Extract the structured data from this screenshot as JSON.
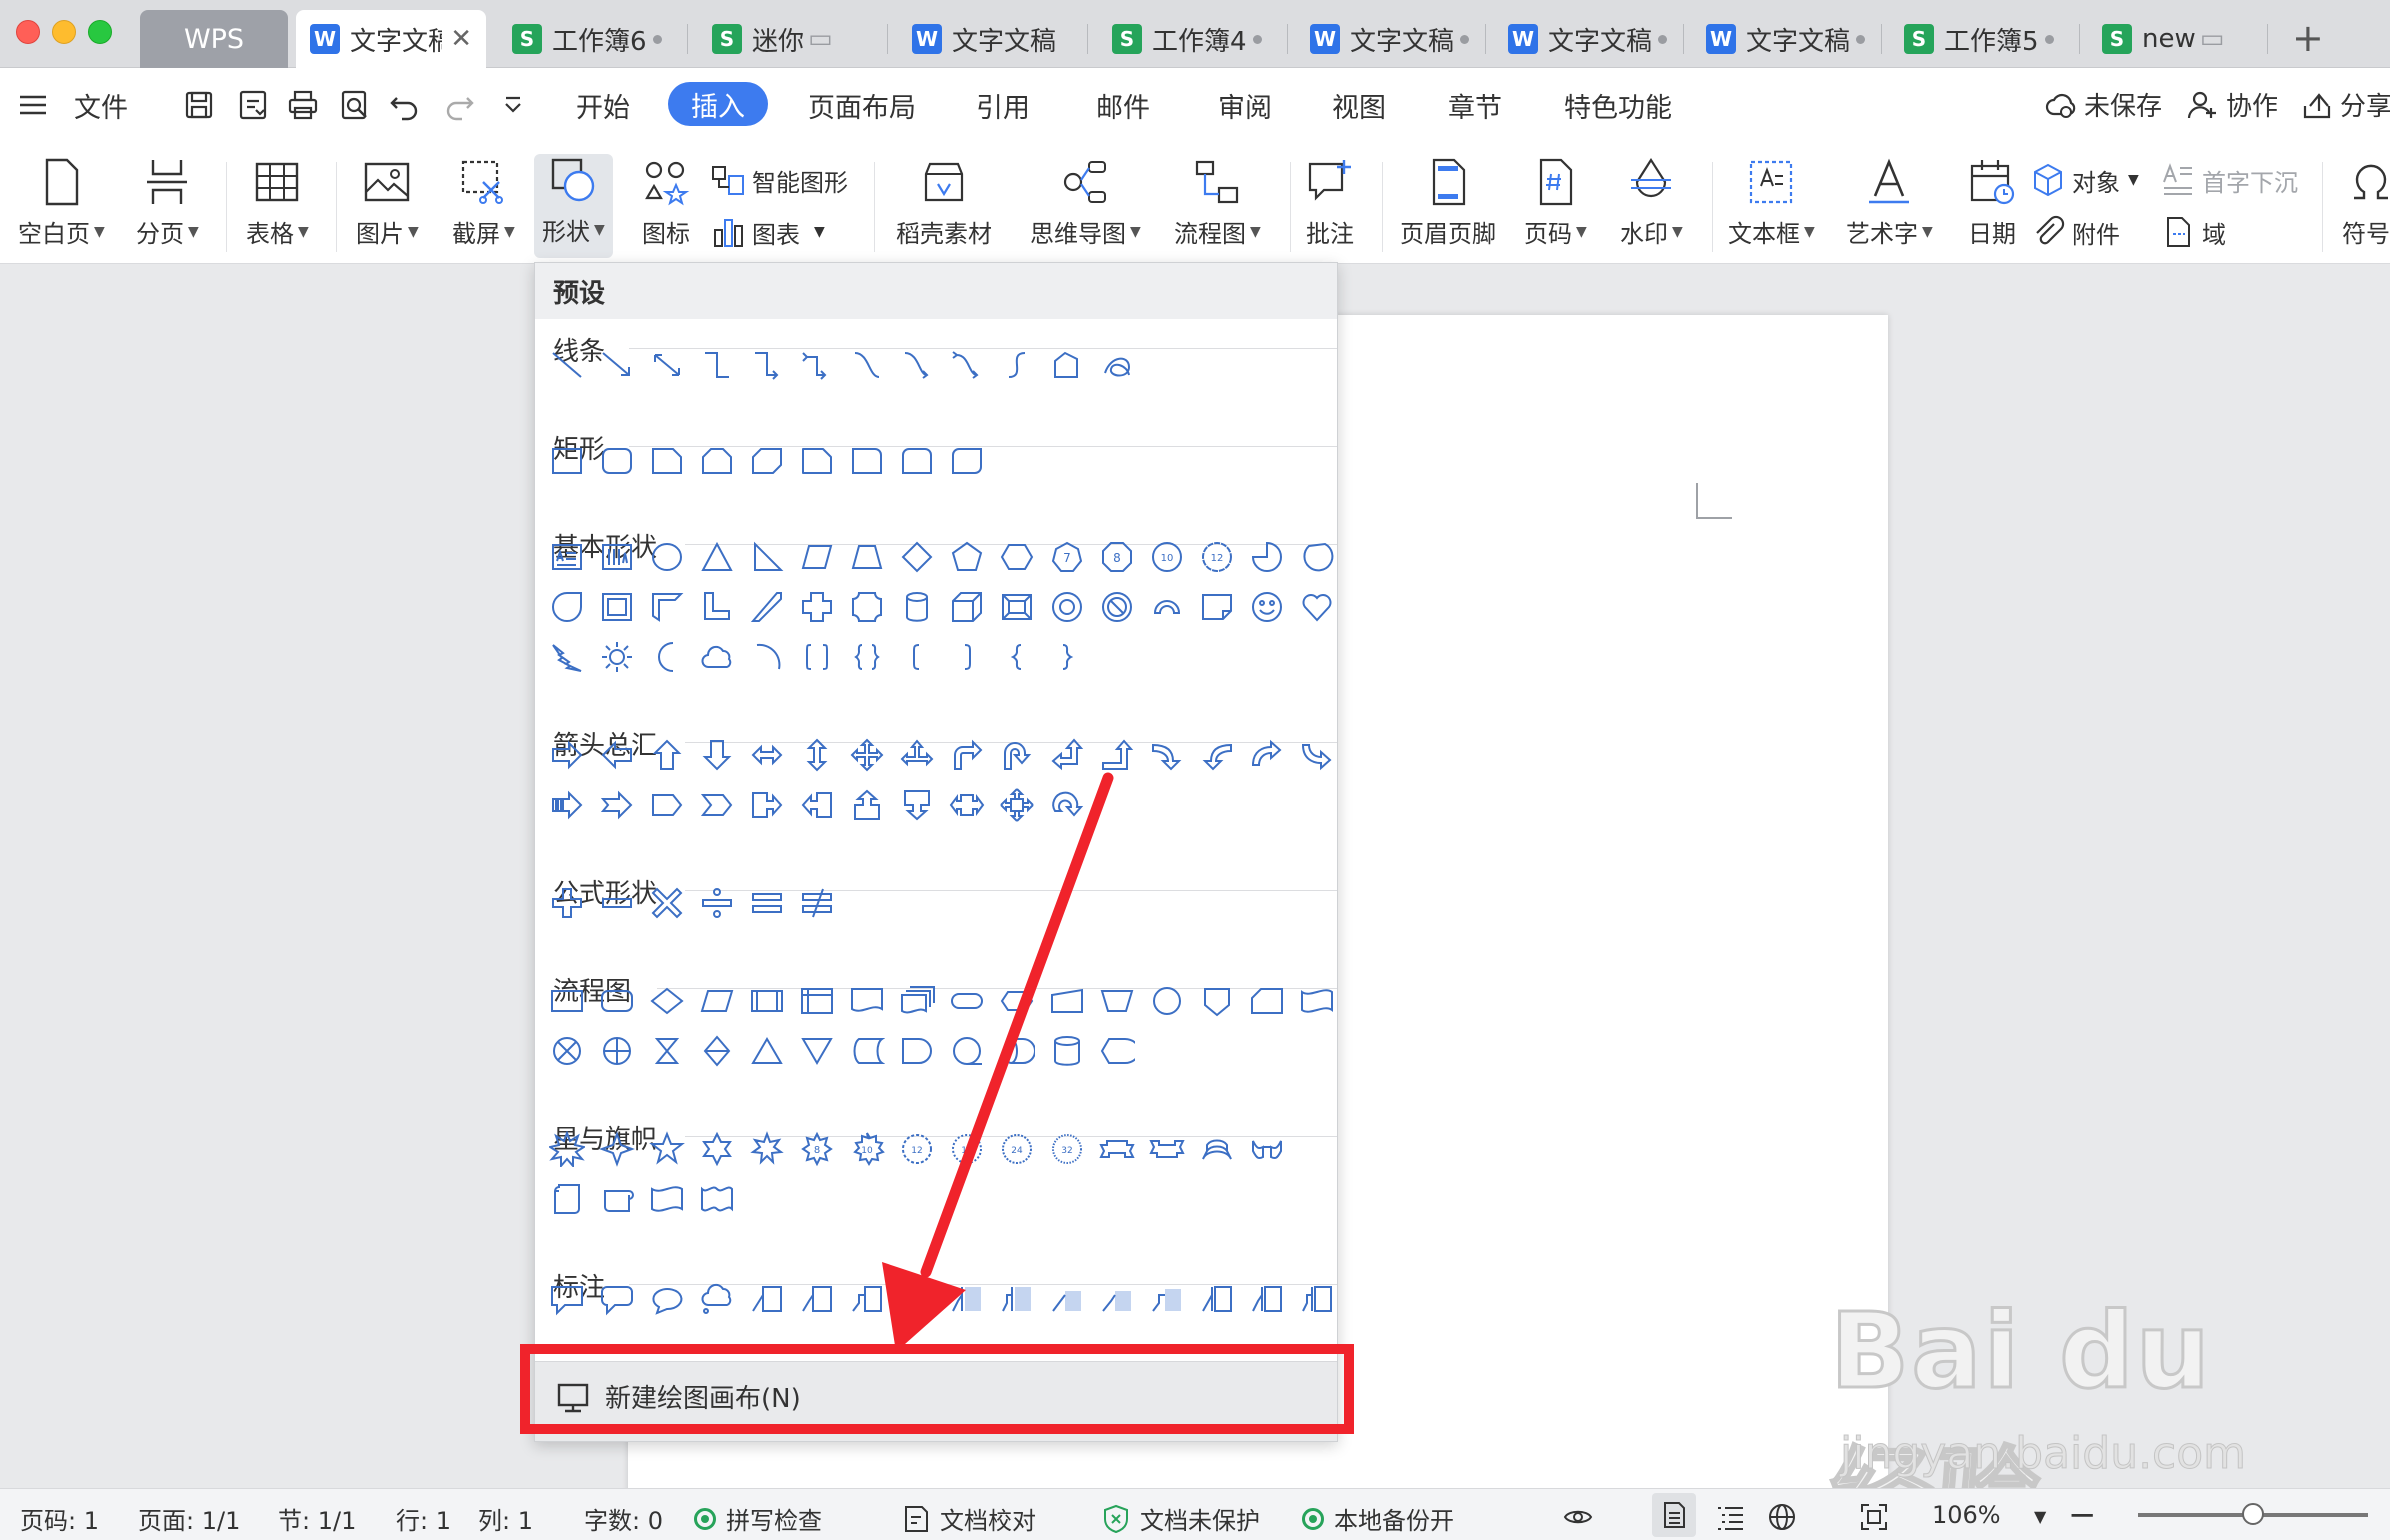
{
  "tabs": {
    "wps": "WPS",
    "items": [
      {
        "type": "W",
        "name": "文字文稿",
        "active": true
      },
      {
        "type": "S",
        "name": "工作簿6"
      },
      {
        "type": "S",
        "name": "迷你"
      },
      {
        "type": "W",
        "name": "文字文稿"
      },
      {
        "type": "S",
        "name": "工作簿4"
      },
      {
        "type": "W",
        "name": "文字文稿"
      },
      {
        "type": "W",
        "name": "文字文稿"
      },
      {
        "type": "W",
        "name": "文字文稿"
      },
      {
        "type": "S",
        "name": "工作簿5"
      },
      {
        "type": "S",
        "name": "new"
      }
    ],
    "new_tab": "+"
  },
  "menu": {
    "file": "文件",
    "tabs": [
      "开始",
      "插入",
      "页面布局",
      "引用",
      "邮件",
      "审阅",
      "视图",
      "章节",
      "特色功能"
    ],
    "active_tab": "插入",
    "unsaved": "未保存",
    "collab": "协作",
    "share": "分享"
  },
  "ribbon": {
    "blank_page": "空白页",
    "page_break": "分页",
    "table": "表格",
    "picture": "图片",
    "screenshot": "截屏",
    "shapes": "形状",
    "icons": "图标",
    "smart_graphic": "智能图形",
    "chart": "图表",
    "docer": "稻壳素材",
    "mindmap": "思维导图",
    "flowchart": "流程图",
    "comment": "批注",
    "header_footer": "页眉页脚",
    "page_number": "页码",
    "watermark": "水印",
    "textbox": "文本框",
    "wordart": "艺术字",
    "date": "日期",
    "object": "对象",
    "attachment": "附件",
    "dropcap": "首字下沉",
    "field": "域",
    "symbol": "符号"
  },
  "dropdown": {
    "header": "预设",
    "sections": {
      "lines": "线条",
      "rects": "矩形",
      "basic": "基本形状",
      "arrows": "箭头总汇",
      "formula": "公式形状",
      "flow": "流程图",
      "stars": "星与旗帜",
      "callouts": "标注"
    },
    "new_canvas": "新建绘图画布(N)"
  },
  "watermark": {
    "brand": "Bai du 经验",
    "url": "jingyan.baidu.com"
  },
  "status": {
    "page_no": "页码: 1",
    "pages": "页面: 1/1",
    "section": "节: 1/1",
    "row": "行: 1",
    "col": "列: 1",
    "words": "字数: 0",
    "spell": "拼写检查",
    "proof": "文档校对",
    "protect": "文档未保护",
    "backup": "本地备份开",
    "zoom": "106%"
  },
  "colors": {
    "accent": "#3d7bef",
    "shape_stroke": "#3c6fc4",
    "annotation_red": "#f0232b",
    "green": "#27a35a"
  }
}
